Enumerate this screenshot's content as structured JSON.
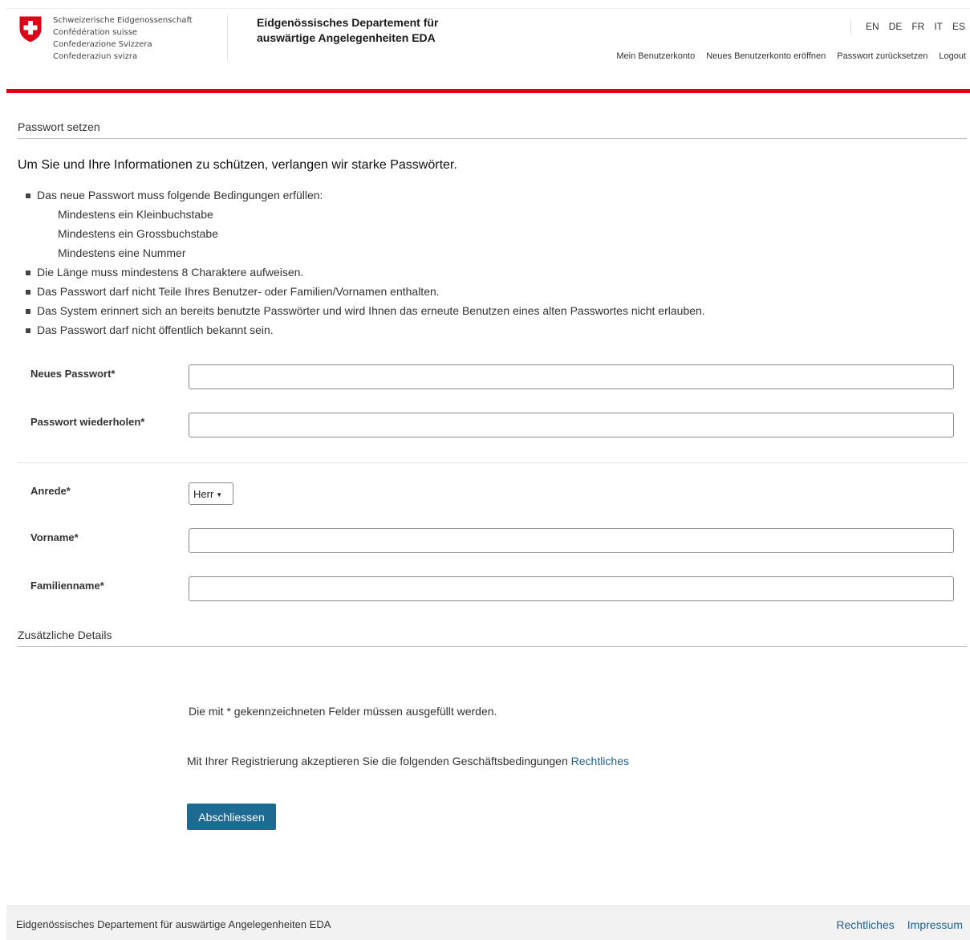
{
  "header": {
    "confederation": [
      "Schweizerische Eidgenossenschaft",
      "Confédération suisse",
      "Confederazione Svizzera",
      "Confederaziun svizra"
    ],
    "department": "Eidgenössisches Departement für auswärtige Angelegenheiten EDA",
    "languages": [
      "EN",
      "DE",
      "FR",
      "IT",
      "ES"
    ],
    "meta_nav": [
      "Mein Benutzerkonto",
      "Neues Benutzerkonto eröffnen",
      "Passwort zurücksetzen",
      "Logout"
    ],
    "accent_color": "#dc0018"
  },
  "page": {
    "section_title": "Passwort setzen",
    "intro": "Um Sie und Ihre Informationen zu schützen, verlangen wir starke Passwörter.",
    "rules": {
      "r1": "Das neue Passwort muss folgende Bedingungen erfüllen:",
      "s1": "Mindestens ein Kleinbuchstabe",
      "s2": "Mindestens ein Grossbuchstabe",
      "s3": "Mindestens eine Nummer",
      "r2": "Die Länge muss mindestens 8 Charaktere aufweisen.",
      "r3": "Das Passwort darf nicht Teile Ihres Benutzer- oder Familien/Vornamen enthalten.",
      "r4": "Das System erinnert sich an bereits benutzte Passwörter und wird Ihnen das erneute Benutzen eines alten Passwortes nicht erlauben.",
      "r5": "Das Passwort darf nicht öffentlich bekannt sein."
    }
  },
  "form": {
    "new_password": {
      "label": "Neues Passwort*",
      "value": ""
    },
    "repeat_password": {
      "label": "Passwort wiederholen*",
      "value": ""
    },
    "salutation": {
      "label": "Anrede*",
      "value": "Herr"
    },
    "first_name": {
      "label": "Vorname*",
      "value": ""
    },
    "last_name": {
      "label": "Familienname*",
      "value": ""
    },
    "extra_details": "Zusätzliche Details",
    "required_note": "Die mit * gekennzeichneten Felder müssen ausgefüllt werden.",
    "terms_text": "Mit Ihrer Registrierung akzeptieren Sie die folgenden Geschäftsbedingungen",
    "terms_link": "Rechtliches",
    "submit_label": "Abschliessen",
    "button_color": "#1d6a93"
  },
  "footer": {
    "text": "Eidgenössisches Departement für auswärtige Angelegenheiten EDA",
    "links": [
      "Rechtliches",
      "Impressum"
    ],
    "link_color": "#1f5f8b"
  }
}
